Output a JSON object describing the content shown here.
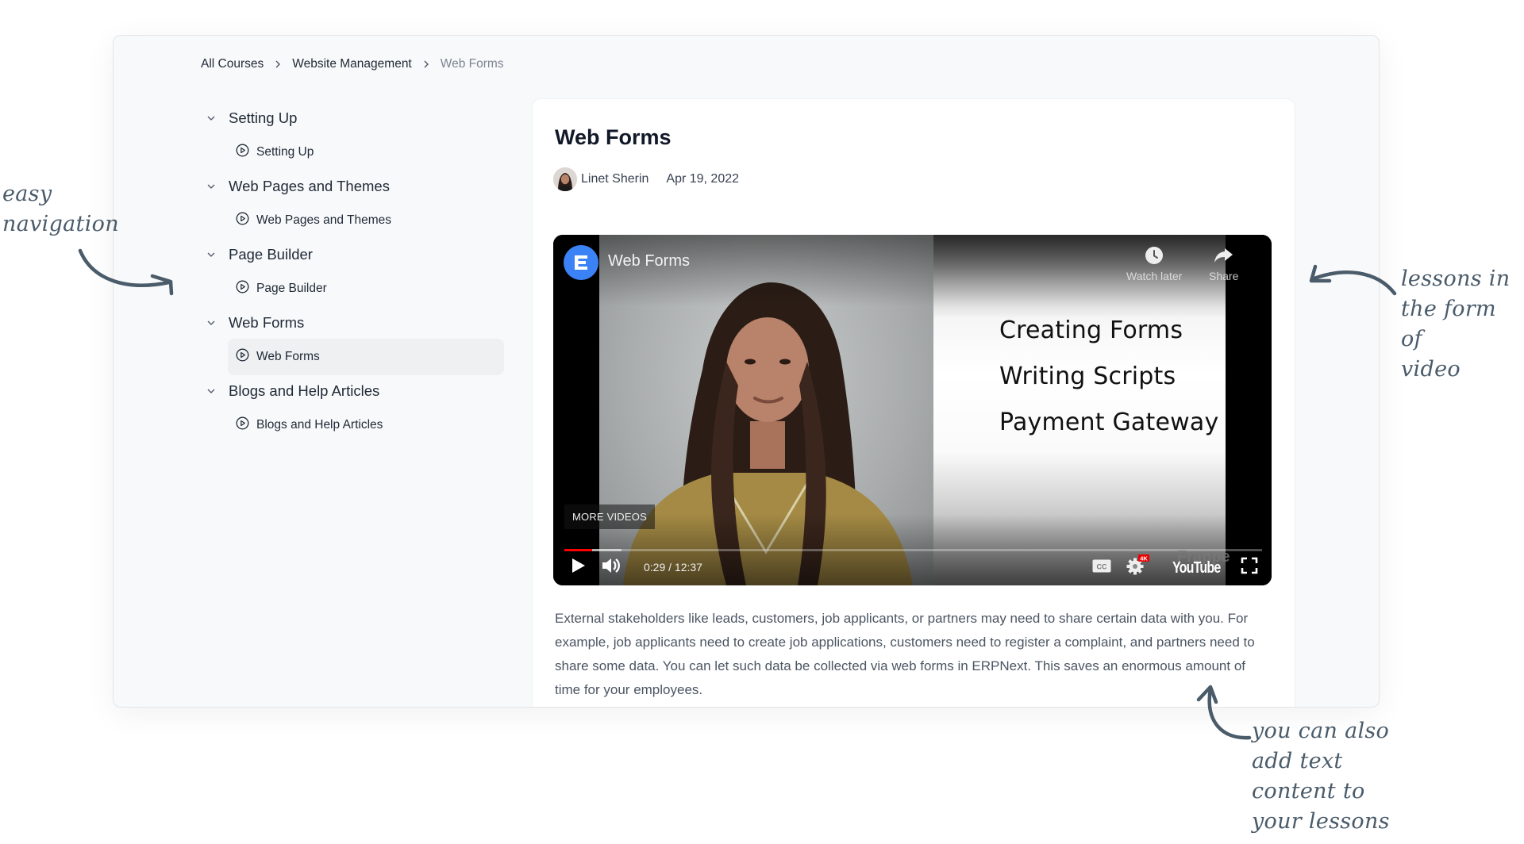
{
  "breadcrumb": {
    "items": [
      "All Courses",
      "Website Management",
      "Web Forms"
    ]
  },
  "sidebar": {
    "chapters": [
      {
        "title": "Setting Up",
        "lessons": [
          {
            "title": "Setting Up",
            "active": false
          }
        ]
      },
      {
        "title": "Web Pages and Themes",
        "lessons": [
          {
            "title": "Web Pages and Themes",
            "active": false
          }
        ]
      },
      {
        "title": "Page Builder",
        "lessons": [
          {
            "title": "Page Builder",
            "active": false
          }
        ]
      },
      {
        "title": "Web Forms",
        "lessons": [
          {
            "title": "Web Forms",
            "active": true
          }
        ]
      },
      {
        "title": "Blogs and Help Articles",
        "lessons": [
          {
            "title": "Blogs and Help Articles",
            "active": false
          }
        ]
      }
    ]
  },
  "lesson": {
    "title": "Web Forms",
    "author": "Linet Sherin",
    "date": "Apr 19, 2022",
    "body": "External stakeholders like leads, customers, job applicants, or partners may need to share certain data with you. For example, job applicants need to create job applications, customers need to register a complaint, and partners need to share some data. You can let such data be collected via web forms in ERPNext. This saves an enormous amount of time for your employees."
  },
  "video": {
    "title": "Web Forms",
    "channel_logo_letter": "E",
    "watch_later_label": "Watch later",
    "share_label": "Share",
    "more_videos_label": "MORE VIDEOS",
    "slide_lines": [
      "Creating Forms",
      "Writing Scripts",
      "Payment Gateway"
    ],
    "current_time": "0:29",
    "duration": "12:37",
    "time_display": "0:29 / 12:37",
    "played_fraction": 0.04,
    "buffered_fraction": 0.082,
    "quality_badge": "4K",
    "watermark": "Frappe",
    "platform_logo": "YouTube",
    "icons": [
      "play-icon",
      "volume-icon",
      "cc-icon",
      "settings-icon",
      "fullscreen-icon",
      "clock-icon",
      "share-icon"
    ]
  },
  "annotations": {
    "left": [
      "easy",
      "navigation"
    ],
    "right": [
      "lessons in",
      "the form of",
      "video"
    ],
    "bottom": [
      "you can also",
      "add text",
      "content to",
      "your lessons"
    ]
  },
  "colors": {
    "panel_bg": "#f8f9fa",
    "active_lesson_bg": "#eef0f2",
    "channel_logo": "#3b82f6",
    "progress_played": "#ff0000",
    "annotation": "#4a5b6a"
  }
}
